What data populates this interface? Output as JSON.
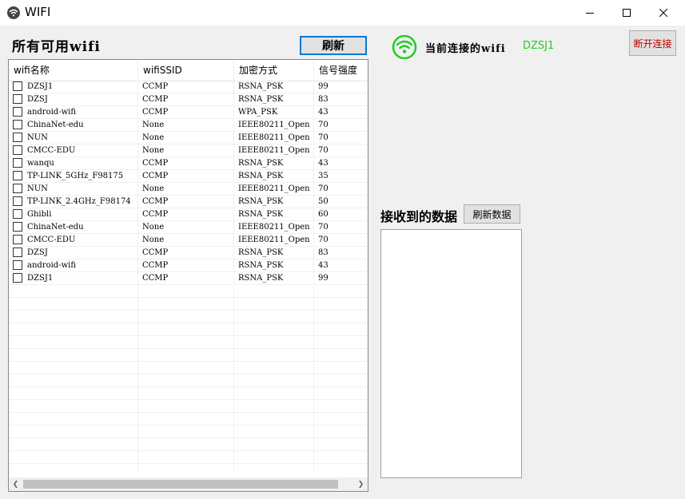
{
  "window": {
    "title": "WIFI"
  },
  "left": {
    "title": "所有可用wifi",
    "refresh_label": "刷新",
    "columns": [
      "wifi名称",
      "wifiSSID",
      "加密方式",
      "信号强度"
    ],
    "rows": [
      {
        "name": "DZSJ1",
        "ssid": "CCMP",
        "enc": "RSNA_PSK",
        "signal": "99"
      },
      {
        "name": "DZSJ",
        "ssid": "CCMP",
        "enc": "RSNA_PSK",
        "signal": "83"
      },
      {
        "name": "android-wifi",
        "ssid": "CCMP",
        "enc": "WPA_PSK",
        "signal": "43"
      },
      {
        "name": "ChinaNet-edu",
        "ssid": "None",
        "enc": "IEEE80211_Open",
        "signal": "70"
      },
      {
        "name": "NUN",
        "ssid": "None",
        "enc": "IEEE80211_Open",
        "signal": "70"
      },
      {
        "name": "CMCC-EDU",
        "ssid": "None",
        "enc": "IEEE80211_Open",
        "signal": "70"
      },
      {
        "name": "wanqu",
        "ssid": "CCMP",
        "enc": "RSNA_PSK",
        "signal": "43"
      },
      {
        "name": "TP-LINK_5GHz_F98175",
        "ssid": "CCMP",
        "enc": "RSNA_PSK",
        "signal": "35"
      },
      {
        "name": "NUN",
        "ssid": "None",
        "enc": "IEEE80211_Open",
        "signal": "70"
      },
      {
        "name": "TP-LINK_2.4GHz_F98174",
        "ssid": "CCMP",
        "enc": "RSNA_PSK",
        "signal": "50"
      },
      {
        "name": "Ghibli",
        "ssid": "CCMP",
        "enc": "RSNA_PSK",
        "signal": "60"
      },
      {
        "name": "ChinaNet-edu",
        "ssid": "None",
        "enc": "IEEE80211_Open",
        "signal": "70"
      },
      {
        "name": "CMCC-EDU",
        "ssid": "None",
        "enc": "IEEE80211_Open",
        "signal": "70"
      },
      {
        "name": "DZSJ",
        "ssid": "CCMP",
        "enc": "RSNA_PSK",
        "signal": "83"
      },
      {
        "name": "android-wifi",
        "ssid": "CCMP",
        "enc": "RSNA_PSK",
        "signal": "43"
      },
      {
        "name": "DZSJ1",
        "ssid": "CCMP",
        "enc": "RSNA_PSK",
        "signal": "99"
      }
    ]
  },
  "right": {
    "current_label": "当前连接的wifi",
    "current_ssid": "DZSJ1",
    "disconnect_label": "断开连接",
    "received_label": "接收到的数据",
    "refresh_data_label": "刷新数据",
    "received_text": ""
  },
  "colors": {
    "ssid_green": "#22cc22",
    "wifi_icon_green": "#22cc22",
    "disconnect_red": "#c00000"
  }
}
